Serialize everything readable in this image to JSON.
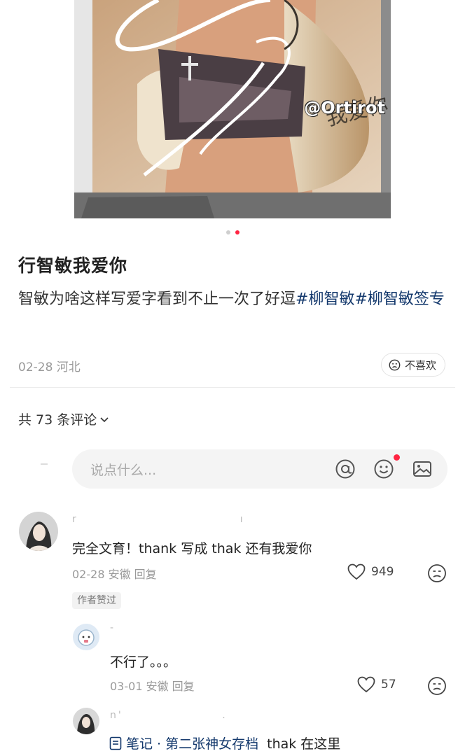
{
  "photo": {
    "watermark": "@Ortirot",
    "signature": "我爱你"
  },
  "carousel": {
    "total": 2,
    "active": 2
  },
  "post": {
    "title": "行智敏我爱你",
    "body_text": "智敏为啥这样写爱字看到不止一次了好逗",
    "tag1": "#柳智敏",
    "tag2": "#柳智敏签专",
    "date_location": "02-28 河北",
    "dislike_label": "不喜欢"
  },
  "comments_header": {
    "count_label": "共 73 条评论",
    "input_placeholder": "说点什么..."
  },
  "comments": [
    {
      "text": "完全文育！thank 写成 thak 还有我爱你",
      "meta": "02-28 安徽 回复",
      "likes": "949",
      "badge": "作者赞过"
    },
    {
      "text": "不行了。。。",
      "meta": "03-01 安徽 回复",
      "likes": "57"
    },
    {
      "note_label": "笔记 · 第二张神女存档",
      "note_text": "thak 在这里"
    }
  ],
  "colors": {
    "accent": "#ff2442",
    "tag": "#13386c",
    "muted": "#999999"
  },
  "icons": [
    "at-icon",
    "emoji-icon",
    "image-icon",
    "heart-icon",
    "sad-face-icon",
    "note-icon",
    "chevron-down-icon",
    "dislike-face-icon"
  ]
}
